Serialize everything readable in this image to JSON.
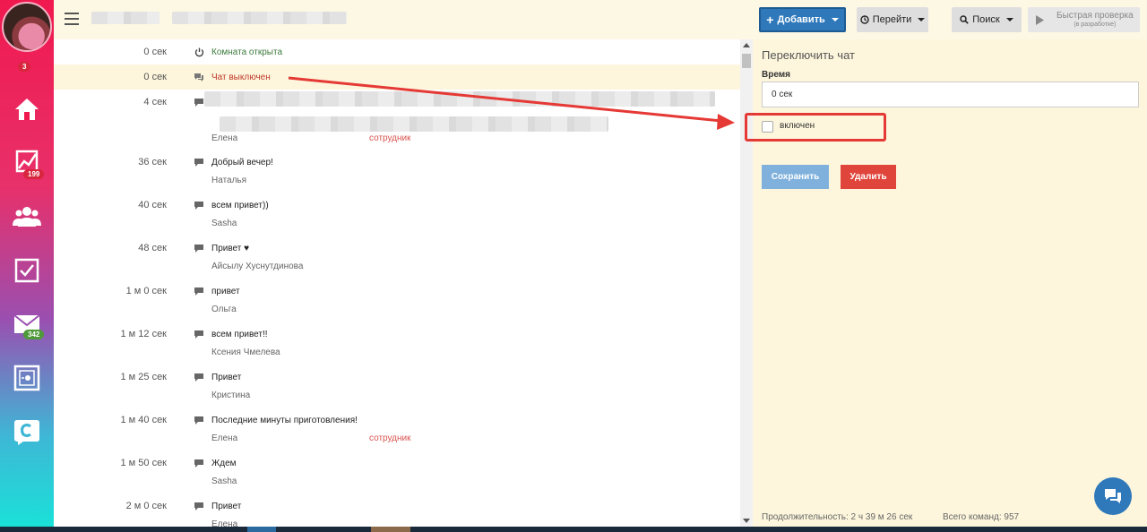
{
  "sidebar": {
    "avatar_badge": "3",
    "items": [
      {
        "icon": "home-icon"
      },
      {
        "icon": "chart-icon",
        "badge": "199"
      },
      {
        "icon": "users-icon"
      },
      {
        "icon": "checkbox-icon"
      },
      {
        "icon": "mail-icon",
        "badge": "342"
      },
      {
        "icon": "safe-icon"
      },
      {
        "icon": "logo-c-icon"
      }
    ]
  },
  "toolbar": {
    "add_label": "Добавить",
    "goto_label": "Перейти",
    "search_label": "Поиск",
    "quick_check_label": "Быстрая проверка",
    "quick_check_sub": "(в разработке)"
  },
  "log": [
    {
      "time": "0 сек",
      "icon": "power-icon",
      "message": "Комната открыта",
      "tone": "green"
    },
    {
      "time": "0 сек",
      "icon": "comments-icon",
      "message": "Чат выключен",
      "tone": "red",
      "highlight": true
    },
    {
      "time": "4 сек",
      "icon": "comment-icon",
      "message": "",
      "author": "Елена",
      "role": "сотрудник",
      "blurred": true
    },
    {
      "time": "36 сек",
      "icon": "comment-icon",
      "message": "Добрый вечер!",
      "author": "Наталья"
    },
    {
      "time": "40 сек",
      "icon": "comment-icon",
      "message": "всем привет))",
      "author": "Sasha"
    },
    {
      "time": "48 сек",
      "icon": "comment-icon",
      "message": "Привет ♥",
      "author": "Айсылу Хуснутдинова"
    },
    {
      "time": "1 м 0 сек",
      "icon": "comment-icon",
      "message": "привет",
      "author": "Ольга"
    },
    {
      "time": "1 м 12 сек",
      "icon": "comment-icon",
      "message": "всем привет!!",
      "author": "Ксения Чмелева"
    },
    {
      "time": "1 м 25 сек",
      "icon": "comment-icon",
      "message": "Привет",
      "author": "Кристина"
    },
    {
      "time": "1 м 40 сек",
      "icon": "comment-icon",
      "message": "Последние минуты приготовления!",
      "author": "Елена",
      "role": "сотрудник"
    },
    {
      "time": "1 м 50 сек",
      "icon": "comment-icon",
      "message": "Ждем",
      "author": "Sasha"
    },
    {
      "time": "2 м 0 сек",
      "icon": "comment-icon",
      "message": "Привет",
      "author": "Елена"
    }
  ],
  "panel": {
    "title": "Переключить чат",
    "time_label": "Время",
    "time_value": "0 сек",
    "checkbox_label": "включен",
    "checkbox_checked": false,
    "save_label": "Сохранить",
    "delete_label": "Удалить",
    "duration": "Продолжительность: 2 ч 39 м 26 сек",
    "total_commands": "Всего команд: 957"
  },
  "colors": {
    "primary": "#2f79bb",
    "danger": "#e0453c",
    "annotation": "#e53935",
    "panel_bg": "#fdf6dc"
  }
}
